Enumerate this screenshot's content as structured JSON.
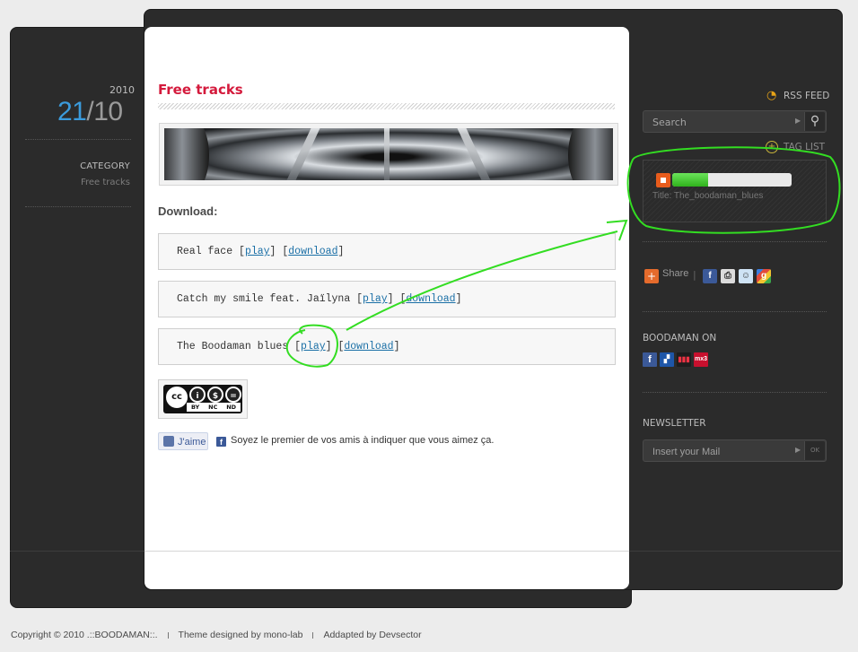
{
  "date": {
    "year": "2010",
    "day": "21",
    "slash": "/",
    "month": "10"
  },
  "category": {
    "label": "CATEGORY",
    "value": "Free tracks"
  },
  "post": {
    "title": "Free tracks",
    "download_heading": "Download:",
    "tracks": [
      {
        "name": "Real face",
        "play": "play",
        "download": "download"
      },
      {
        "name": "Catch my smile feat. Jaïlyna",
        "play": "play",
        "download": "download"
      },
      {
        "name": "The Boodaman blues",
        "play": "play",
        "download": "download"
      }
    ],
    "cc_badge": {
      "top": [
        "cc",
        "i",
        "$",
        "="
      ],
      "bottom": [
        "BY",
        "NC",
        "ND"
      ]
    },
    "like": {
      "button": "J'aime",
      "text": "Soyez le premier de vos amis à indiquer que vous aimez ça."
    }
  },
  "sidebar": {
    "rss_feed": "RSS FEED",
    "search": {
      "placeholder": "Search"
    },
    "tag_list": "TAG LIST",
    "player": {
      "title": "Title: The_boodaman_blues",
      "progress": 0.3
    },
    "share": {
      "label": "Share",
      "separator": "|"
    },
    "boodaman_on": "BOODAMAN ON",
    "newsletter": {
      "heading": "NEWSLETTER",
      "placeholder": "Insert your Mail",
      "button": "OK"
    }
  },
  "footer": {
    "copyright": "Copyright ©  2010  .::BOODAMAN::.",
    "theme": "Theme designed by mono-lab",
    "adapted": "Addapted by Devsector"
  },
  "colors": {
    "accent": "#d41a3c",
    "date_day": "#3b9bdc",
    "annotation": "#33dd22",
    "player_progress": "#3cc427"
  }
}
